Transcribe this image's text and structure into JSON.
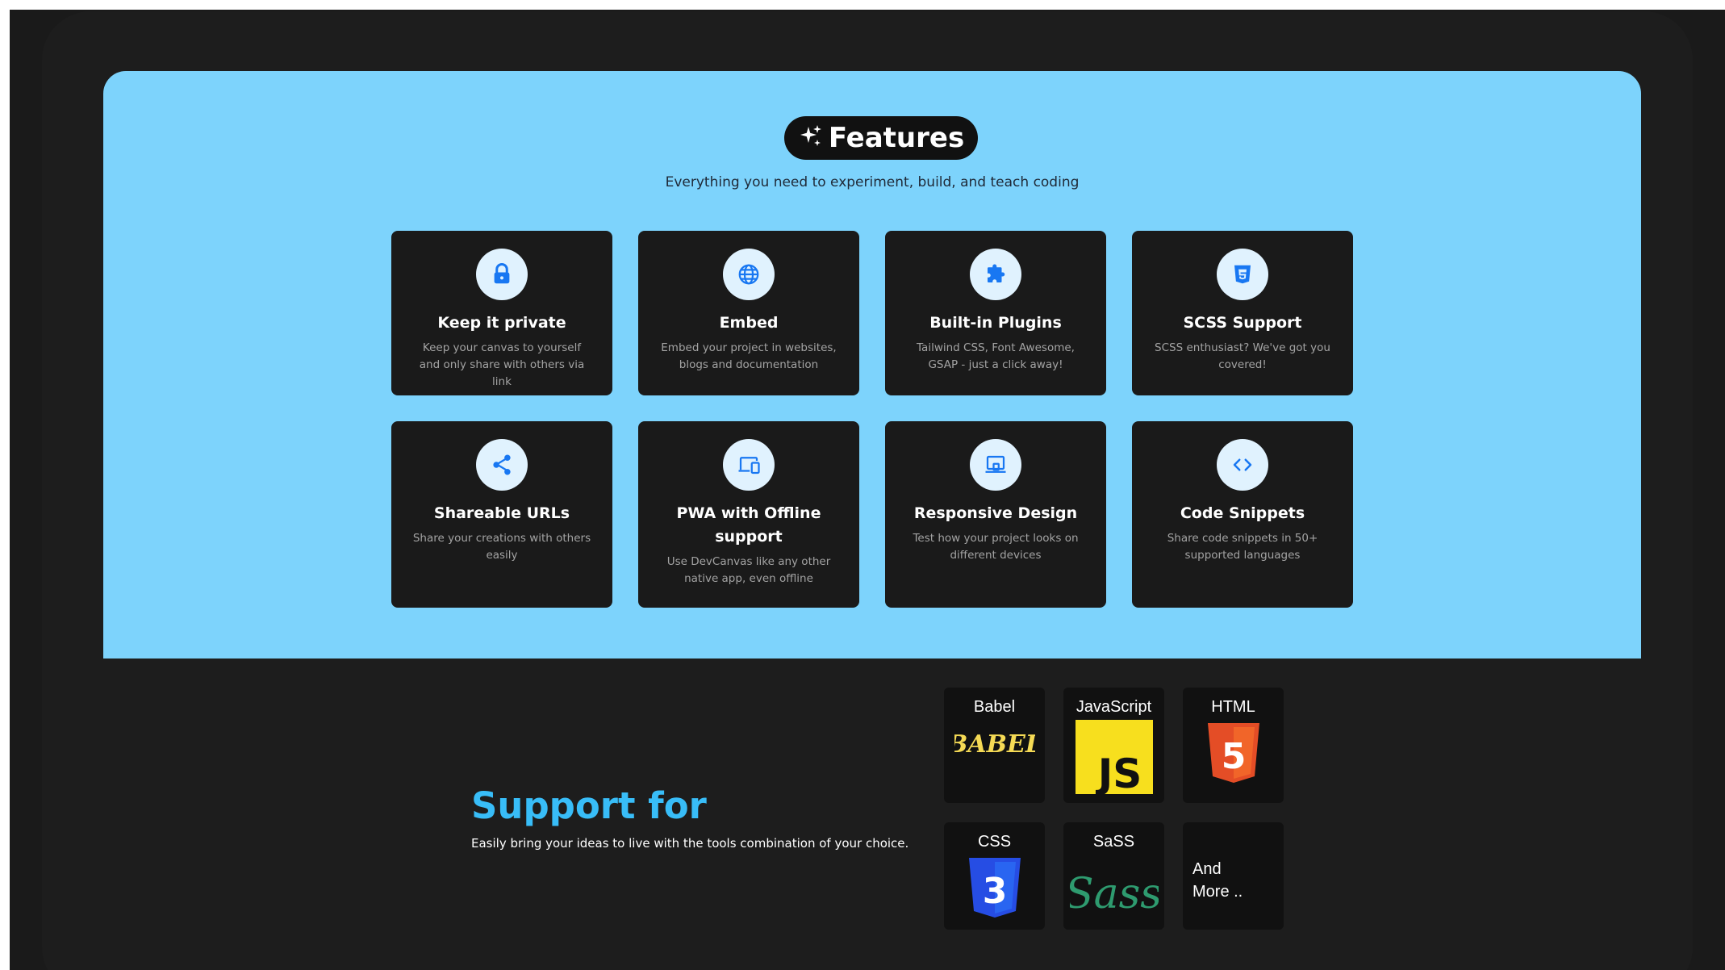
{
  "features": {
    "badge_label": "Features",
    "badge_icon": "sparkles-icon",
    "subtitle": "Everything you need to experiment, build, and teach coding",
    "accent_color": "#1877f2",
    "section_background": "#7dd3fc",
    "cards": [
      {
        "title": "Keep it private",
        "description": "Keep your canvas to yourself and only share with others via link",
        "icon": "lock-icon"
      },
      {
        "title": "Embed",
        "description": "Embed your project in websites, blogs and documentation",
        "icon": "globe-icon"
      },
      {
        "title": "Built-in Plugins",
        "description": "Tailwind CSS, Font Awesome, GSAP - just a click away!",
        "icon": "puzzle-icon"
      },
      {
        "title": "SCSS Support",
        "description": "SCSS enthusiast? We've got you covered!",
        "icon": "css3-icon"
      },
      {
        "title": "Shareable URLs",
        "description": "Share your creations with others easily",
        "icon": "share-icon"
      },
      {
        "title": "PWA with Offline support",
        "description": "Use DevCanvas like any other native app, even offline",
        "icon": "devices-icon"
      },
      {
        "title": "Responsive Design",
        "description": "Test how your project looks on different devices",
        "icon": "laptop-icon"
      },
      {
        "title": "Code Snippets",
        "description": "Share code snippets in 50+ supported languages",
        "icon": "code-icon"
      }
    ]
  },
  "support": {
    "title": "Support for",
    "description": "Easily bring your ideas to live with the tools combination of your choice.",
    "title_color": "#38bdf8",
    "tools": [
      {
        "label": "Babel",
        "logo_text": "BABEL",
        "icon": "babel-logo-icon"
      },
      {
        "label": "JavaScript",
        "logo_text": "JS",
        "icon": "javascript-logo-icon"
      },
      {
        "label": "HTML",
        "logo_text": "5",
        "icon": "html5-logo-icon"
      },
      {
        "label": "CSS",
        "logo_text": "3",
        "icon": "css3-logo-icon"
      },
      {
        "label": "SaSS",
        "logo_text": "Sass",
        "icon": "sass-logo-icon"
      },
      {
        "label": "And More .."
      }
    ]
  }
}
